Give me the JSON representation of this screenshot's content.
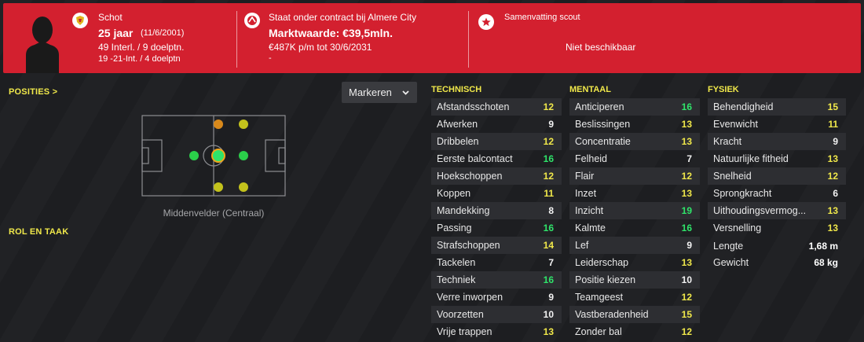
{
  "header": {
    "nationality_name": "Schot",
    "age": "25 jaar",
    "birth_date": "(11/6/2001)",
    "caps_line": "49 Interl. / 9 doelptn.",
    "u21_line": "19 -21-Int. / 4 doelptn",
    "contract_line": "Staat onder contract bij Almere City",
    "market_value": "Marktwaarde: €39,5mln.",
    "wage_line": "€487K p/m tot 30/6/2031",
    "dash": "-",
    "scout_title": "Samenvatting scout",
    "scout_status": "Niet beschikbaar"
  },
  "left": {
    "positions_title": "POSITIES",
    "positions_chevron": ">",
    "dropdown_value": "Markeren",
    "role_title": "ROL EN TAAK",
    "role_label": "Middenvelder (Centraal)"
  },
  "colors": {
    "green": "#2fe46a",
    "yellow": "#f0e84a",
    "white": "#f2f2f2",
    "header_red": "#d3202f"
  },
  "technical": {
    "title": "TECHNISCH",
    "items": [
      {
        "label": "Afstandsschoten",
        "value": "12",
        "tone": "yellow"
      },
      {
        "label": "Afwerken",
        "value": "9",
        "tone": "white"
      },
      {
        "label": "Dribbelen",
        "value": "12",
        "tone": "yellow"
      },
      {
        "label": "Eerste balcontact",
        "value": "16",
        "tone": "green"
      },
      {
        "label": "Hoekschoppen",
        "value": "12",
        "tone": "yellow"
      },
      {
        "label": "Koppen",
        "value": "11",
        "tone": "yellow"
      },
      {
        "label": "Mandekking",
        "value": "8",
        "tone": "white"
      },
      {
        "label": "Passing",
        "value": "16",
        "tone": "green"
      },
      {
        "label": "Strafschoppen",
        "value": "14",
        "tone": "yellow"
      },
      {
        "label": "Tackelen",
        "value": "7",
        "tone": "white"
      },
      {
        "label": "Techniek",
        "value": "16",
        "tone": "green"
      },
      {
        "label": "Verre inworpen",
        "value": "9",
        "tone": "white"
      },
      {
        "label": "Voorzetten",
        "value": "10",
        "tone": "white"
      },
      {
        "label": "Vrije trappen",
        "value": "13",
        "tone": "yellow"
      }
    ]
  },
  "mental": {
    "title": "MENTAAL",
    "items": [
      {
        "label": "Anticiperen",
        "value": "16",
        "tone": "green"
      },
      {
        "label": "Beslissingen",
        "value": "13",
        "tone": "yellow"
      },
      {
        "label": "Concentratie",
        "value": "13",
        "tone": "yellow"
      },
      {
        "label": "Felheid",
        "value": "7",
        "tone": "white"
      },
      {
        "label": "Flair",
        "value": "12",
        "tone": "yellow"
      },
      {
        "label": "Inzet",
        "value": "13",
        "tone": "yellow"
      },
      {
        "label": "Inzicht",
        "value": "19",
        "tone": "green"
      },
      {
        "label": "Kalmte",
        "value": "16",
        "tone": "green"
      },
      {
        "label": "Lef",
        "value": "9",
        "tone": "white"
      },
      {
        "label": "Leiderschap",
        "value": "13",
        "tone": "yellow"
      },
      {
        "label": "Positie kiezen",
        "value": "10",
        "tone": "white"
      },
      {
        "label": "Teamgeest",
        "value": "12",
        "tone": "yellow"
      },
      {
        "label": "Vastberadenheid",
        "value": "15",
        "tone": "yellow"
      },
      {
        "label": "Zonder bal",
        "value": "12",
        "tone": "yellow"
      }
    ]
  },
  "physical": {
    "title": "FYSIEK",
    "items": [
      {
        "label": "Behendigheid",
        "value": "15",
        "tone": "yellow"
      },
      {
        "label": "Evenwicht",
        "value": "11",
        "tone": "yellow"
      },
      {
        "label": "Kracht",
        "value": "9",
        "tone": "white"
      },
      {
        "label": "Natuurlijke fitheid",
        "value": "13",
        "tone": "yellow"
      },
      {
        "label": "Snelheid",
        "value": "12",
        "tone": "yellow"
      },
      {
        "label": "Sprongkracht",
        "value": "6",
        "tone": "white"
      },
      {
        "label": "Uithoudingsvermog...",
        "value": "13",
        "tone": "yellow"
      },
      {
        "label": "Versnelling",
        "value": "13",
        "tone": "yellow"
      }
    ],
    "height_label": "Lengte",
    "height_value": "1,68 m",
    "weight_label": "Gewicht",
    "weight_value": "68 kg"
  }
}
